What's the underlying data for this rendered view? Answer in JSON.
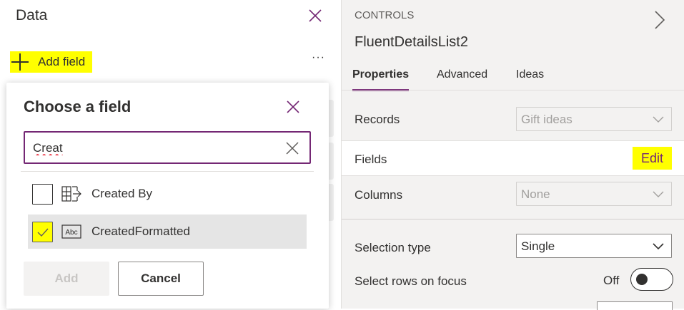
{
  "data_pane": {
    "title": "Data",
    "add_field_label": "Add field",
    "more_label": "···"
  },
  "chooser": {
    "title": "Choose a field",
    "search_value": "Creat",
    "fields": [
      {
        "name": "Created By",
        "checked": false,
        "icon": "person-field-icon"
      },
      {
        "name": "CreatedFormatted",
        "checked": true,
        "icon": "text-field-icon",
        "icon_text": "Abc"
      }
    ],
    "add_label": "Add",
    "cancel_label": "Cancel"
  },
  "props": {
    "section_label": "CONTROLS",
    "control_name": "FluentDetailsList2",
    "tabs": [
      "Properties",
      "Advanced",
      "Ideas"
    ],
    "active_tab": "Properties",
    "records": {
      "label": "Records",
      "value": "Gift ideas"
    },
    "fields": {
      "label": "Fields",
      "edit_label": "Edit"
    },
    "columns": {
      "label": "Columns",
      "value": "None"
    },
    "selection_type": {
      "label": "Selection type",
      "value": "Single"
    },
    "select_rows_on_focus": {
      "label": "Select rows on focus",
      "state": "Off"
    }
  },
  "colors": {
    "accent": "#742774",
    "highlight": "#ffff00",
    "pane_bg": "#f3f2f1"
  }
}
